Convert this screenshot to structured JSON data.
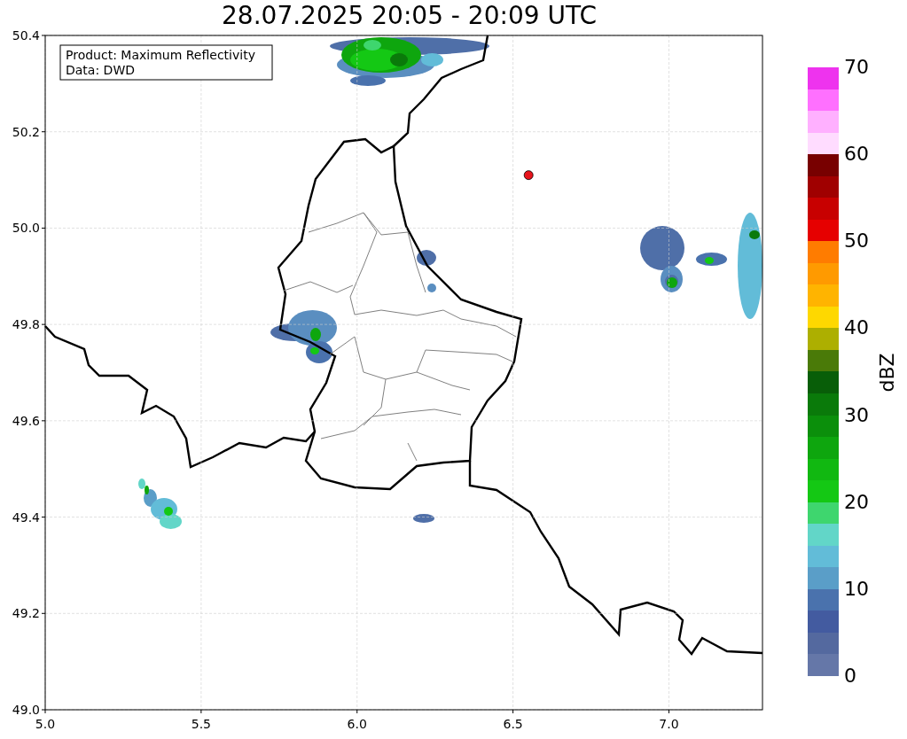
{
  "title": "28.07.2025 20:05 - 20:09 UTC",
  "map": {
    "annotation": [
      "Product: Maximum Reflectivity",
      "Data: DWD"
    ],
    "chart_data": {
      "type": "scatter",
      "xlim": [
        5.0,
        7.3
      ],
      "ylim": [
        49.0,
        50.4
      ],
      "xticks": [
        {
          "value": 5,
          "label": "5.0"
        },
        {
          "value": 5.5,
          "label": "5.5"
        },
        {
          "value": 6,
          "label": "6.0"
        },
        {
          "value": 6.5,
          "label": "6.5"
        },
        {
          "value": 7,
          "label": "7.0"
        }
      ],
      "yticks": [
        {
          "value": 49,
          "label": "49.0"
        },
        {
          "value": 49.2,
          "label": "49.2"
        },
        {
          "value": 49.4,
          "label": "49.4"
        },
        {
          "value": 49.6,
          "label": "49.6"
        },
        {
          "value": 49.8,
          "label": "49.8"
        },
        {
          "value": 50,
          "label": "50.0"
        },
        {
          "value": 50.2,
          "label": "50.2"
        },
        {
          "value": 50.4,
          "label": "50.4"
        }
      ],
      "grid": true,
      "x": [
        6.55
      ],
      "series": [
        {
          "color": "#e8141c",
          "values": [
            50.11
          ]
        }
      ]
    }
  },
  "colorbar": {
    "label": "dBZ",
    "ticks": [
      "70",
      "60",
      "50",
      "40",
      "30",
      "20",
      "10",
      "0"
    ],
    "segments": [
      {
        "color": "#ee33ee"
      },
      {
        "color": "#ff70ff"
      },
      {
        "color": "#ffb0ff"
      },
      {
        "color": "#ffdcff"
      },
      {
        "color": "#780000"
      },
      {
        "color": "#a00000"
      },
      {
        "color": "#c80000"
      },
      {
        "color": "#e60000"
      },
      {
        "color": "#ff7c00"
      },
      {
        "color": "#ff9a00"
      },
      {
        "color": "#ffb400"
      },
      {
        "color": "#fed800"
      },
      {
        "color": "#adaf00"
      },
      {
        "color": "#4a7a08"
      },
      {
        "color": "#085e08"
      },
      {
        "color": "#0a7a0a"
      },
      {
        "color": "#0b8f0b"
      },
      {
        "color": "#0ea60e"
      },
      {
        "color": "#11b811"
      },
      {
        "color": "#14c814"
      },
      {
        "color": "#3ed66e"
      },
      {
        "color": "#62d6c8"
      },
      {
        "color": "#62bcd8"
      },
      {
        "color": "#5a9ec8"
      },
      {
        "color": "#4a72ad"
      },
      {
        "color": "#435ba0"
      },
      {
        "color": "#54699f"
      },
      {
        "color": "#6577a8"
      }
    ]
  }
}
